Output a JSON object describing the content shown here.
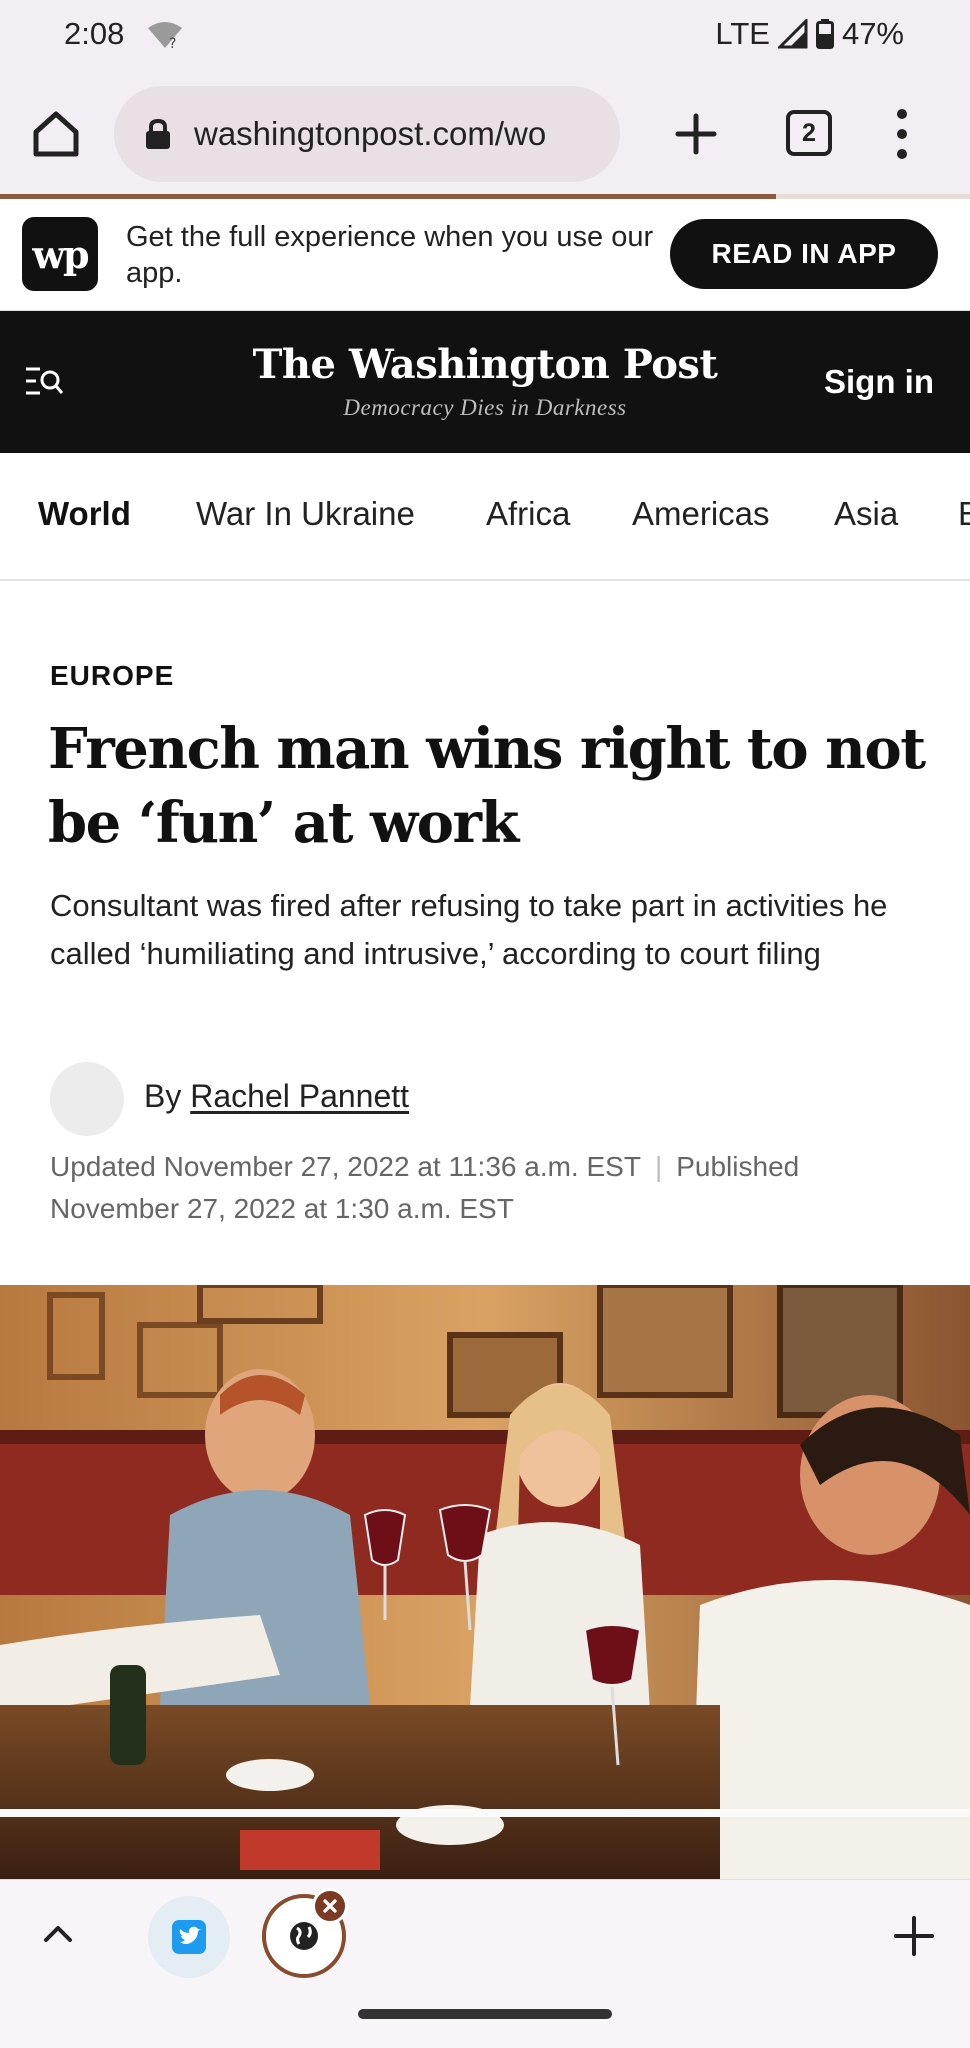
{
  "status_bar": {
    "time": "2:08",
    "network": "LTE",
    "battery": "47%",
    "icons": [
      "wifi-question-icon",
      "signal-icon",
      "battery-icon"
    ]
  },
  "browser": {
    "url": "washingtonpost.com/wo",
    "tab_count": "2",
    "load_progress": 0.8,
    "icons": [
      "home-icon",
      "lock-icon",
      "plus-icon",
      "tab-switcher-icon",
      "more-vert-icon"
    ]
  },
  "app_banner": {
    "logo": "wp",
    "text": "Get the full experience when you use our app.",
    "cta": "READ IN APP"
  },
  "masthead": {
    "title": "The Washington Post",
    "tagline": "Democracy Dies in Darkness",
    "sign_in": "Sign in"
  },
  "section_nav": {
    "items": [
      {
        "label": "World",
        "active": true
      },
      {
        "label": "War In Ukraine",
        "active": false
      },
      {
        "label": "Africa",
        "active": false
      },
      {
        "label": "Americas",
        "active": false
      },
      {
        "label": "Asia",
        "active": false
      },
      {
        "label": "E",
        "active": false
      }
    ]
  },
  "article": {
    "kicker": "EUROPE",
    "headline": "French man wins right to not be ‘fun’ at work",
    "dek": "Consultant was fired after refusing to take part in activities he called ‘humiliating and intrusive,’ according to court filing",
    "byline_prefix": "By",
    "author": "Rachel Pannett",
    "updated": "Updated November 27, 2022 at 11:36 a.m. EST",
    "separator": "|",
    "published": "Published November 27, 2022 at 1:30 a.m. EST"
  },
  "bottom_bar": {
    "icons": [
      "chevron-up-icon",
      "twitter-icon",
      "globe-icon",
      "close-icon",
      "plus-icon"
    ]
  },
  "colors": {
    "masthead_bg": "#111111",
    "progress": "#8a5a40",
    "twitter": "#1d9bf0",
    "globe_ring": "#8a4a2c"
  }
}
